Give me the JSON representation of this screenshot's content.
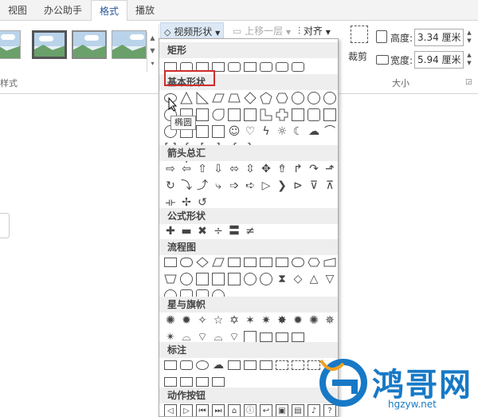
{
  "tabs": [
    {
      "label": "视图"
    },
    {
      "label": "办公助手"
    },
    {
      "label": "格式"
    },
    {
      "label": "播放"
    }
  ],
  "ribbon": {
    "styles_group_label": "样式",
    "video_shape_button": "视频形状",
    "bring_forward_button": "上移一层",
    "align_button": "对齐",
    "crop_button": "裁剪",
    "size_group_label": "大小",
    "height_label": "高度:",
    "height_value": "3.34 厘米",
    "width_label": "宽度:",
    "width_value": "5.94 厘米"
  },
  "shape_menu": {
    "sections": [
      {
        "title": "矩形"
      },
      {
        "title": "基本形状"
      },
      {
        "title": "箭头总汇"
      },
      {
        "title": "公式形状"
      },
      {
        "title": "流程图"
      },
      {
        "title": "星与旗帜"
      },
      {
        "title": "标注"
      },
      {
        "title": "动作按钮"
      }
    ],
    "tooltip": "椭圆",
    "highlight_color": "#d02b2b"
  },
  "watermark": {
    "title": "鸿哥网",
    "url": "hgzyw.net",
    "color": "#1779c6"
  }
}
